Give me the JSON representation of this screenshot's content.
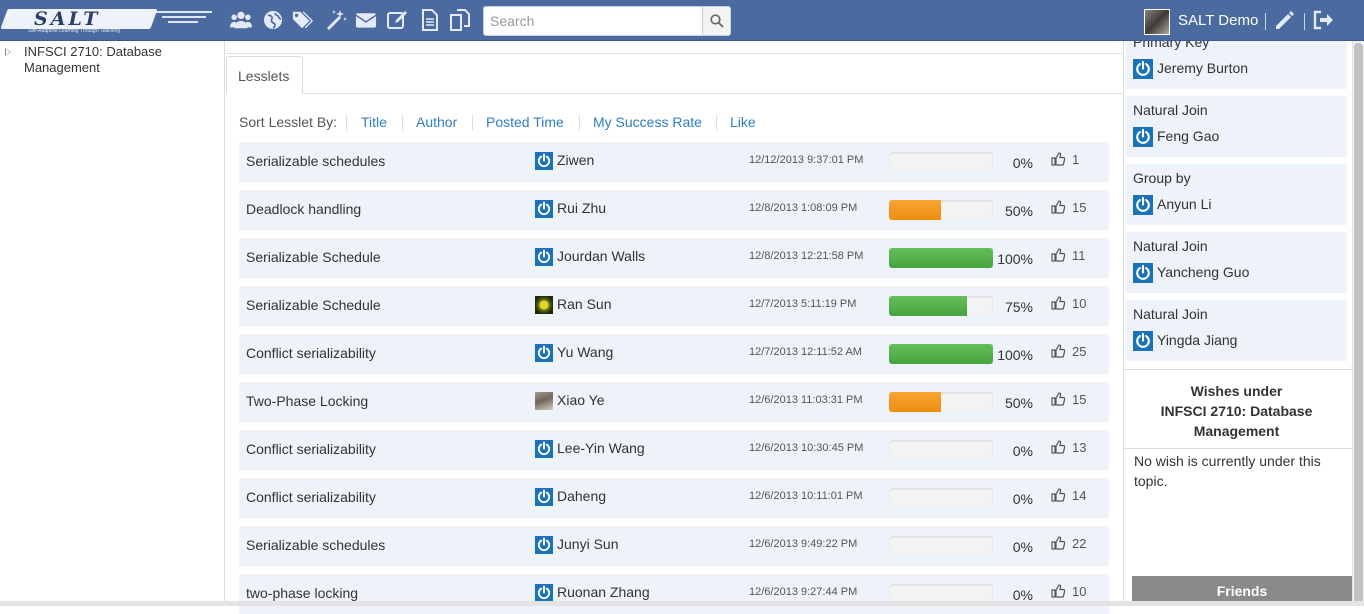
{
  "app": {
    "logo_text": "SALT",
    "logo_subtitle": "Self-Adaptive Learning Through Teaching",
    "search_placeholder": "Search",
    "user_name": "SALT Demo"
  },
  "nav_icons": [
    "users-icon",
    "globe-icon",
    "tags-icon",
    "magic-wand-icon",
    "envelope-icon",
    "edit-icon",
    "document-icon",
    "copy-icon"
  ],
  "sidebar": {
    "topic": "INFSCI 2710: Database Management"
  },
  "main": {
    "tab_label": "Lesslets",
    "sort_label": "Sort Lesslet By:",
    "sort_options": [
      "Title",
      "Author",
      "Posted Time",
      "My Success Rate",
      "Like"
    ],
    "rows": [
      {
        "title": "Serializable schedules",
        "avatar": "power",
        "author": "Ziwen",
        "time": "12/12/2013 9:37:01 PM",
        "rate": 0,
        "pct": "0%",
        "likes": "1",
        "bar_color": "none"
      },
      {
        "title": "Deadlock handling",
        "avatar": "power",
        "author": "Rui Zhu",
        "time": "12/8/2013 1:08:09 PM",
        "rate": 50,
        "pct": "50%",
        "likes": "15",
        "bar_color": "orange"
      },
      {
        "title": "Serializable Schedule",
        "avatar": "power",
        "author": "Jourdan Walls",
        "time": "12/8/2013 12:21:58 PM",
        "rate": 100,
        "pct": "100%",
        "likes": "11",
        "bar_color": "green"
      },
      {
        "title": "Serializable Schedule",
        "avatar": "photo-flower",
        "author": "Ran Sun",
        "time": "12/7/2013 5:11:19 PM",
        "rate": 75,
        "pct": "75%",
        "likes": "10",
        "bar_color": "green"
      },
      {
        "title": "Conflict serializability",
        "avatar": "power",
        "author": "Yu Wang",
        "time": "12/7/2013 12:11:52 AM",
        "rate": 100,
        "pct": "100%",
        "likes": "25",
        "bar_color": "green"
      },
      {
        "title": "Two-Phase Locking",
        "avatar": "photo-man",
        "author": "Xiao Ye",
        "time": "12/6/2013 11:03:31 PM",
        "rate": 50,
        "pct": "50%",
        "likes": "15",
        "bar_color": "orange"
      },
      {
        "title": "Conflict serializability",
        "avatar": "power",
        "author": "Lee-Yin Wang",
        "time": "12/6/2013 10:30:45 PM",
        "rate": 0,
        "pct": "0%",
        "likes": "13",
        "bar_color": "none"
      },
      {
        "title": "Conflict serializability",
        "avatar": "power",
        "author": "Daheng",
        "time": "12/6/2013 10:11:01 PM",
        "rate": 0,
        "pct": "0%",
        "likes": "14",
        "bar_color": "none"
      },
      {
        "title": "Serializable schedules",
        "avatar": "power",
        "author": "Junyi Sun",
        "time": "12/6/2013 9:49:22 PM",
        "rate": 0,
        "pct": "0%",
        "likes": "22",
        "bar_color": "none"
      },
      {
        "title": "two-phase locking",
        "avatar": "power",
        "author": "Ruonan Zhang",
        "time": "12/6/2013 9:27:44 PM",
        "rate": 0,
        "pct": "0%",
        "likes": "10",
        "bar_color": "none"
      }
    ]
  },
  "right": {
    "cards": [
      {
        "topic": "Primary Key",
        "author": "Jeremy Burton"
      },
      {
        "topic": "Natural Join",
        "author": "Feng Gao"
      },
      {
        "topic": "Group by",
        "author": "Anyun Li"
      },
      {
        "topic": "Natural Join",
        "author": "Yancheng Guo"
      },
      {
        "topic": "Natural Join",
        "author": "Yingda Jiang"
      }
    ],
    "wishes_title_line1": "Wishes under",
    "wishes_title_line2": "INFSCI 2710: Database",
    "wishes_title_line3": "Management",
    "wishes_empty": "No wish is currently under this topic.",
    "friends_label": "Friends"
  },
  "colors": {
    "navbar": "#4a6aa0",
    "row_bg": "#eef2f9",
    "link": "#2f7ec2",
    "bar_orange": "#f29b22",
    "bar_green": "#52b048",
    "power_icon": "#1a72b8"
  }
}
